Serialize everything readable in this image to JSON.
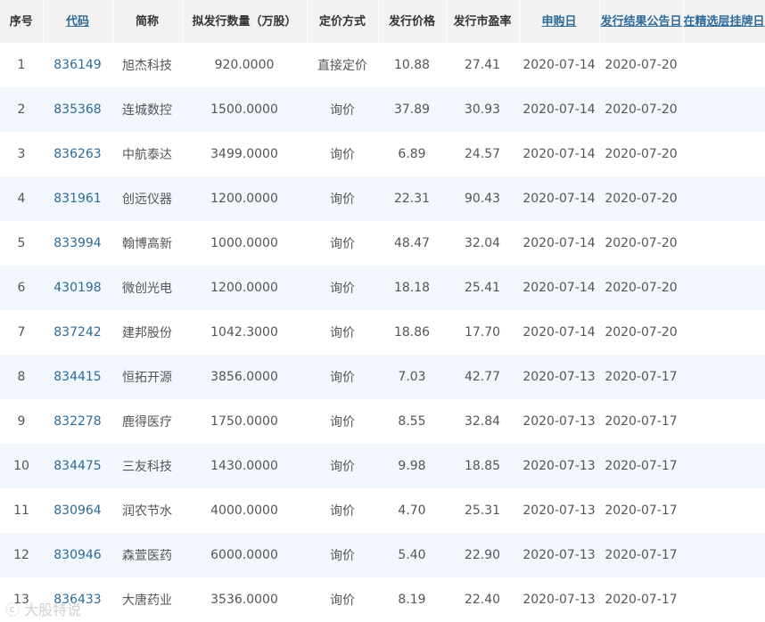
{
  "table": {
    "headers": [
      "序号",
      "代码",
      "简称",
      "拟发行数量（万股）",
      "定价方式",
      "发行价格",
      "发行市盈率",
      "申购日",
      "发行结果公告日",
      "在精选层挂牌日"
    ],
    "rows": [
      [
        "1",
        "836149",
        "旭杰科技",
        "920.0000",
        "直接定价",
        "10.88",
        "27.41",
        "2020-07-14",
        "2020-07-20",
        ""
      ],
      [
        "2",
        "835368",
        "连城数控",
        "1500.0000",
        "询价",
        "37.89",
        "30.93",
        "2020-07-14",
        "2020-07-20",
        ""
      ],
      [
        "3",
        "836263",
        "中航泰达",
        "3499.0000",
        "询价",
        "6.89",
        "24.57",
        "2020-07-14",
        "2020-07-20",
        ""
      ],
      [
        "4",
        "831961",
        "创远仪器",
        "1200.0000",
        "询价",
        "22.31",
        "90.43",
        "2020-07-14",
        "2020-07-20",
        ""
      ],
      [
        "5",
        "833994",
        "翰博高新",
        "1000.0000",
        "询价",
        "48.47",
        "32.04",
        "2020-07-14",
        "2020-07-20",
        ""
      ],
      [
        "6",
        "430198",
        "微创光电",
        "1200.0000",
        "询价",
        "18.18",
        "25.41",
        "2020-07-14",
        "2020-07-20",
        ""
      ],
      [
        "7",
        "837242",
        "建邦股份",
        "1042.3000",
        "询价",
        "18.86",
        "17.70",
        "2020-07-14",
        "2020-07-20",
        ""
      ],
      [
        "8",
        "834415",
        "恒拓开源",
        "3856.0000",
        "询价",
        "7.03",
        "42.77",
        "2020-07-13",
        "2020-07-17",
        ""
      ],
      [
        "9",
        "832278",
        "鹿得医疗",
        "1750.0000",
        "询价",
        "8.55",
        "32.84",
        "2020-07-13",
        "2020-07-17",
        ""
      ],
      [
        "10",
        "834475",
        "三友科技",
        "1430.0000",
        "询价",
        "9.98",
        "18.85",
        "2020-07-13",
        "2020-07-17",
        ""
      ],
      [
        "11",
        "830964",
        "润农节水",
        "4000.0000",
        "询价",
        "4.70",
        "25.31",
        "2020-07-13",
        "2020-07-17",
        ""
      ],
      [
        "12",
        "830946",
        "森萱医药",
        "6000.0000",
        "询价",
        "5.40",
        "22.90",
        "2020-07-13",
        "2020-07-17",
        ""
      ],
      [
        "13",
        "836433",
        "大唐药业",
        "3536.0000",
        "询价",
        "8.19",
        "22.40",
        "2020-07-13",
        "2020-07-17",
        ""
      ]
    ]
  },
  "watermark": "大股特说",
  "colors": {
    "header_bg": "#f2f2f2",
    "stripe_bg": "#f1f7fc",
    "link": "#2e6a9a",
    "text": "#555555"
  }
}
